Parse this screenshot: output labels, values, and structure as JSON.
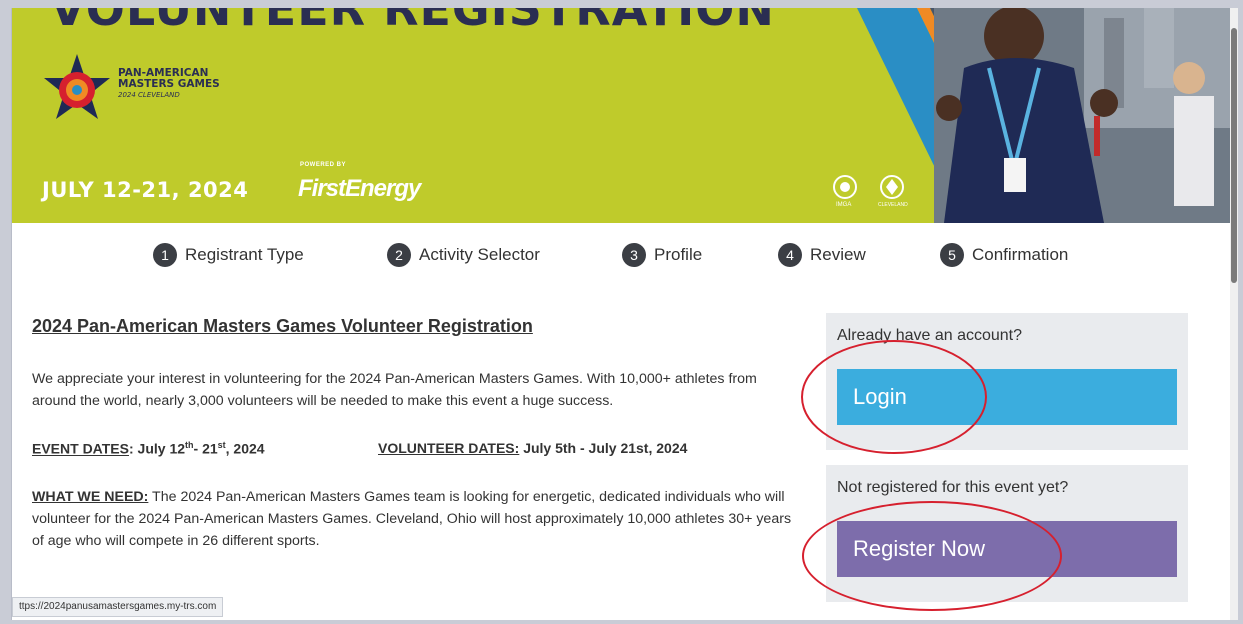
{
  "banner": {
    "title": "VOLUNTEER REGISTRATION",
    "logo_line1": "PAN-AMERICAN",
    "logo_line2": "MASTERS GAMES",
    "logo_line3": "2024 CLEVELAND",
    "dates": "JULY 12-21, 2024",
    "powered_by": "POWERED BY",
    "sponsor": "FirstEnergy",
    "small_logo1": "IMGA",
    "small_logo2": "CLEVELAND"
  },
  "steps": [
    {
      "num": "1",
      "label": "Registrant Type"
    },
    {
      "num": "2",
      "label": "Activity Selector"
    },
    {
      "num": "3",
      "label": "Profile"
    },
    {
      "num": "4",
      "label": "Review"
    },
    {
      "num": "5",
      "label": "Confirmation"
    }
  ],
  "content": {
    "heading": "2024 Pan-American Masters Games Volunteer Registration",
    "intro": "We appreciate your interest in volunteering for the 2024 Pan-American Masters Games. With 10,000+ athletes from around the world, nearly 3,000 volunteers will be needed to make this event a huge success.",
    "event_dates_label": "EVENT DATES",
    "event_dates_value_pre": ": July 12",
    "event_dates_sup1": "th",
    "event_dates_mid": "- 21",
    "event_dates_sup2": "st",
    "event_dates_post": ", 2024",
    "volunteer_dates_label": "VOLUNTEER DATES:",
    "volunteer_dates_value": " July 5th - July 21st, 2024",
    "what_we_need_label": "WHAT WE NEED:",
    "what_we_need_text": " The 2024 Pan-American Masters Games team is looking for energetic, dedicated individuals who will volunteer for the 2024 Pan-American Masters Games. Cleveland, Ohio will host approximately 10,000 athletes 30+ years of age who will compete in 26 different sports."
  },
  "account_panel": {
    "label": "Already have an account?",
    "button": "Login"
  },
  "register_panel": {
    "label": "Not registered for this event yet?",
    "button": "Register Now"
  },
  "status_url": "ttps://2024panusamastersgames.my-trs.com",
  "colors": {
    "banner": "#bfcb2b",
    "login": "#3badde",
    "register": "#7d6dab",
    "annotation": "#d6202e"
  }
}
